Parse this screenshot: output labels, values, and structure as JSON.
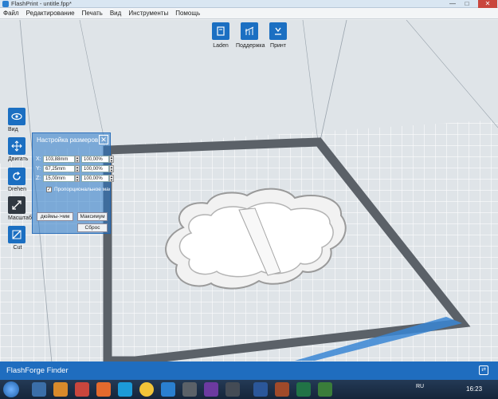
{
  "window": {
    "title": "FlashPrint - untitle.fpp*",
    "minimize": "—",
    "maximize": "□",
    "close": "✕"
  },
  "menu": [
    "Файл",
    "Редактирование",
    "Печать",
    "Вид",
    "Инструменты",
    "Помощь"
  ],
  "top_toolbar": [
    {
      "label": "Laden",
      "icon": "load-icon"
    },
    {
      "label": "Поддержка",
      "icon": "support-icon"
    },
    {
      "label": "Принт",
      "icon": "print-icon"
    }
  ],
  "left_toolbar": [
    {
      "label": "Вид",
      "icon": "eye-icon"
    },
    {
      "label": "Двигать",
      "icon": "move-icon"
    },
    {
      "label": "Drehen",
      "icon": "rotate-icon"
    },
    {
      "label": "Масштаб",
      "icon": "scale-icon"
    },
    {
      "label": "Cut",
      "icon": "cut-icon"
    }
  ],
  "scale_panel": {
    "title": "Настройка размеров",
    "close": "✕",
    "axes": [
      {
        "axis": "X:",
        "size": "103,88mm",
        "percent": "100,00%"
      },
      {
        "axis": "Y:",
        "size": "67,25mm",
        "percent": "100,00%"
      },
      {
        "axis": "Z:",
        "size": "15,00mm",
        "percent": "100,00%"
      }
    ],
    "proportional_label": "Пропорциональное масштабирование",
    "proportional_checked": true,
    "inch_button": "дюймы->мм",
    "max_button": "Максимум",
    "reset_button": "Сброс"
  },
  "bottom_bar": {
    "label": "FlashForge Finder"
  },
  "taskbar": {
    "language": "RU",
    "time": "16:23"
  },
  "colors": {
    "accent": "#1b6fc2",
    "bottom_bar": "#1f6dbf",
    "grid_bg": "#e4e9ed"
  }
}
